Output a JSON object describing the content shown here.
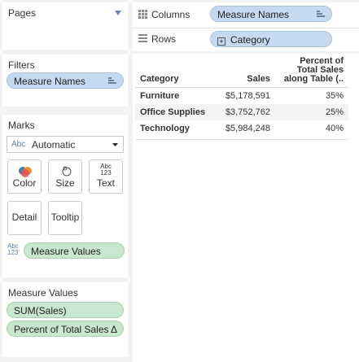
{
  "pages": {
    "title": "Pages"
  },
  "filters": {
    "title": "Filters",
    "items": [
      "Measure Names"
    ]
  },
  "marks": {
    "title": "Marks",
    "type_prefix": "Abc",
    "type_value": "Automatic",
    "buttons": {
      "color": "Color",
      "size": "Size",
      "text": "Text",
      "detail": "Detail",
      "tooltip": "Tooltip"
    },
    "text_icon_top": "Abc",
    "text_icon_bottom": "123",
    "text_pill": "Measure Values"
  },
  "measure_values": {
    "title": "Measure Values",
    "items": [
      "SUM(Sales)",
      "Percent of Total Sales"
    ],
    "delta_symbol": "Δ"
  },
  "columns": {
    "label": "Columns",
    "pill": "Measure Names"
  },
  "rows": {
    "label": "Rows",
    "pill": "Category",
    "expand_symbol": "+"
  },
  "table": {
    "headers": {
      "category": "Category",
      "sales": "Sales",
      "percent_line1": "Percent of",
      "percent_line2": "Total Sales",
      "percent_line3": "along Table (.."
    },
    "rows": [
      {
        "category": "Furniture",
        "sales": "$5,178,591",
        "percent": "35%"
      },
      {
        "category": "Office Supplies",
        "sales": "$3,752,762",
        "percent": "25%"
      },
      {
        "category": "Technology",
        "sales": "$5,984,248",
        "percent": "40%"
      }
    ]
  },
  "colors": {
    "blue_pill": "#c5d9f0",
    "green_pill": "#c9e6cf",
    "row_alt": "#f4f4f4"
  }
}
